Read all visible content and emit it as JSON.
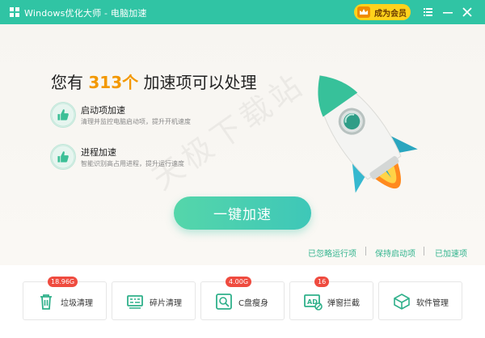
{
  "window": {
    "title": "Windows优化大师 - 电脑加速"
  },
  "titlebar": {
    "vip_label": "成为会员",
    "icons": [
      "crown-icon",
      "menu-icon",
      "minimize-icon",
      "close-icon"
    ]
  },
  "headline": {
    "prefix": "您有",
    "count": "313个",
    "suffix": "加速项可以处理"
  },
  "features": [
    {
      "title": "启动项加速",
      "desc": "清理并监控电脑启动项，提升开机速度",
      "icon": "thumbs-up-icon"
    },
    {
      "title": "进程加速",
      "desc": "智能识别高占用进程，提升运行速度",
      "icon": "thumbs-up-icon"
    }
  ],
  "watermark": "天极下载站",
  "action": {
    "label": "一键加速"
  },
  "links": [
    "已忽略运行项",
    "保持启动项",
    "已加速项"
  ],
  "tools": [
    {
      "label": "垃圾清理",
      "badge": "18.96G",
      "icon": "trash-icon"
    },
    {
      "label": "碎片清理",
      "badge": "",
      "icon": "disk-defrag-icon"
    },
    {
      "label": "C盘瘦身",
      "badge": "4.00G",
      "icon": "disk-search-icon"
    },
    {
      "label": "弹窗拦截",
      "badge": "16",
      "icon": "ad-block-icon"
    },
    {
      "label": "软件管理",
      "badge": "",
      "icon": "box-icon"
    }
  ],
  "colors": {
    "accent": "#30c4a4",
    "highlight": "#f39800",
    "badge": "#ef4b3f",
    "vip": "#ffd21c"
  }
}
